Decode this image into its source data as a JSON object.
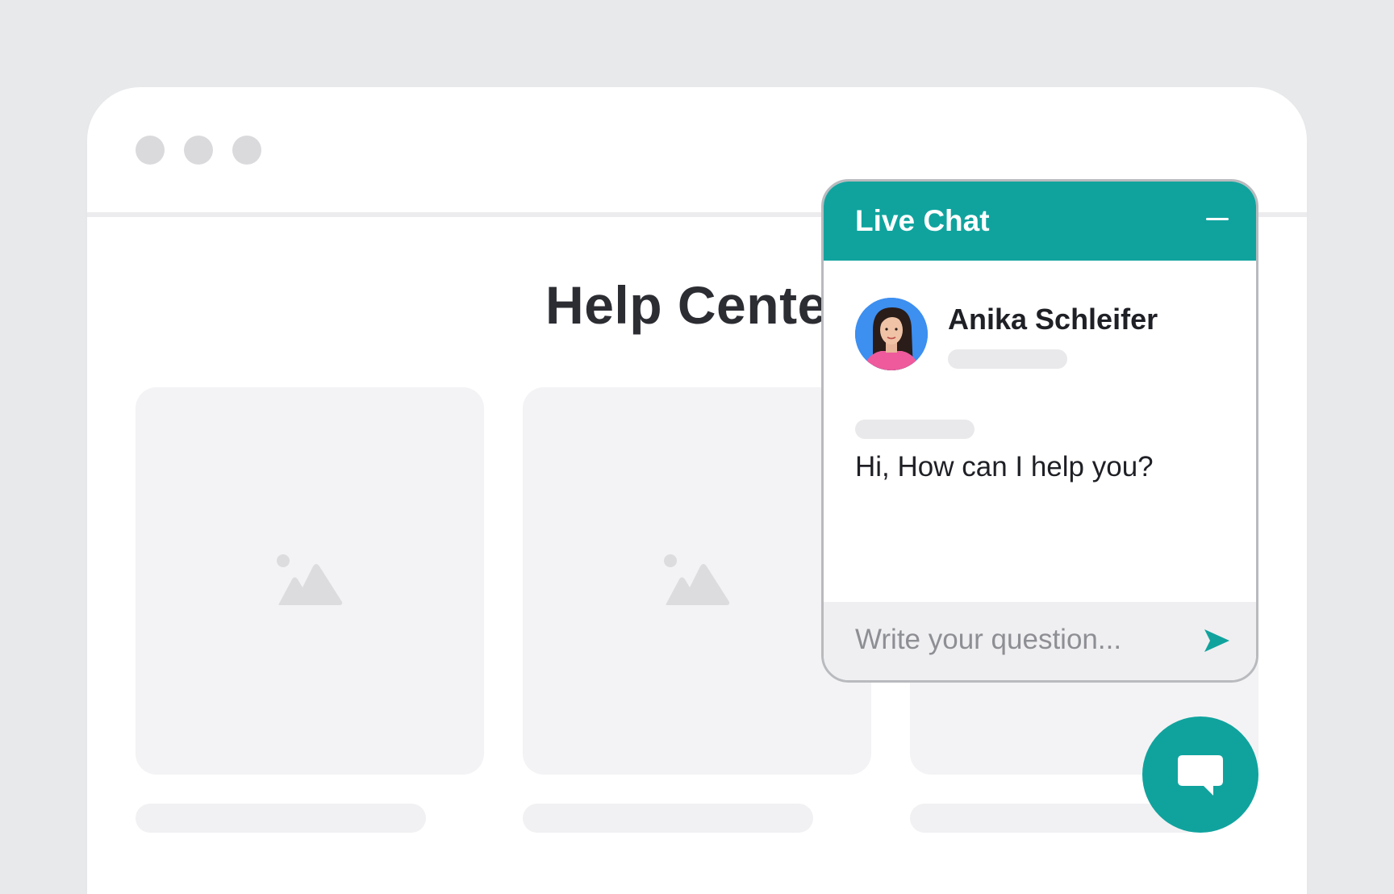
{
  "page": {
    "title": "Help Center",
    "cards": [
      {
        "image_icon": "image-placeholder-icon"
      },
      {
        "image_icon": "image-placeholder-icon"
      },
      {
        "image_icon": "image-placeholder-icon"
      }
    ]
  },
  "chat": {
    "title": "Live Chat",
    "minimize_icon": "minimize-icon",
    "agent": {
      "name": "Anika Schleifer",
      "avatar_icon": "avatar"
    },
    "message": "Hi, How can I help you?",
    "input": {
      "value": "",
      "placeholder": "Write your question..."
    },
    "send_icon": "send-icon"
  },
  "launcher": {
    "icon": "chat-bubble-icon"
  },
  "colors": {
    "accent": "#10a39e",
    "background": "#e8e9eb",
    "card": "#f3f3f5",
    "title_text": "#2c2d33",
    "avatar_bg": "#3d8ff0"
  }
}
